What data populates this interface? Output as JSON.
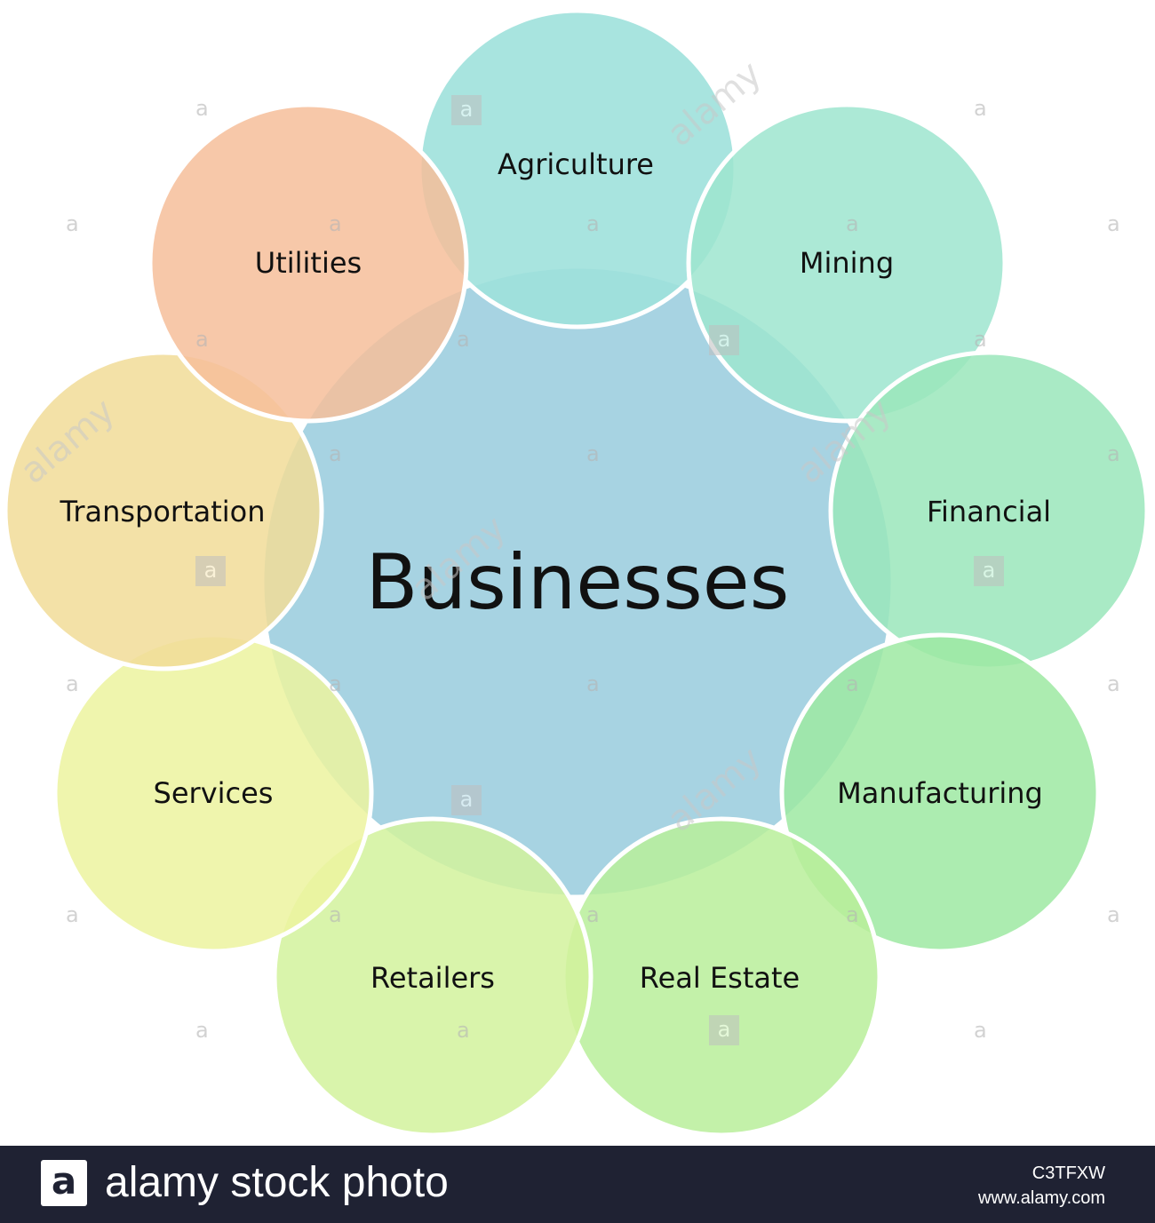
{
  "diagram": {
    "center_label": "Businesses",
    "colors": {
      "center": "#a7d3e2",
      "agriculture": "#9fe1dc",
      "mining": "#9ee5cf",
      "financial": "#9ae6bb",
      "manufacturing": "#9ee9a2",
      "real_estate": "#b9ef9a",
      "retailers": "#d2f29c",
      "services": "#ecf39f",
      "transportation": "#f1dc98",
      "utilities": "#f6be9a",
      "outline": "#ffffff"
    },
    "nodes": [
      {
        "label": "Agriculture"
      },
      {
        "label": "Mining"
      },
      {
        "label": "Financial"
      },
      {
        "label": "Manufacturing"
      },
      {
        "label": "Real Estate"
      },
      {
        "label": "Retailers"
      },
      {
        "label": "Services"
      },
      {
        "label": "Transportation"
      },
      {
        "label": "Utilities"
      }
    ]
  },
  "watermark": {
    "glyph": "a",
    "word": "alamy"
  },
  "footer": {
    "logo_glyph": "a",
    "brand": "alamy stock photo",
    "image_id": "C3TFXW",
    "url": "www.alamy.com"
  }
}
